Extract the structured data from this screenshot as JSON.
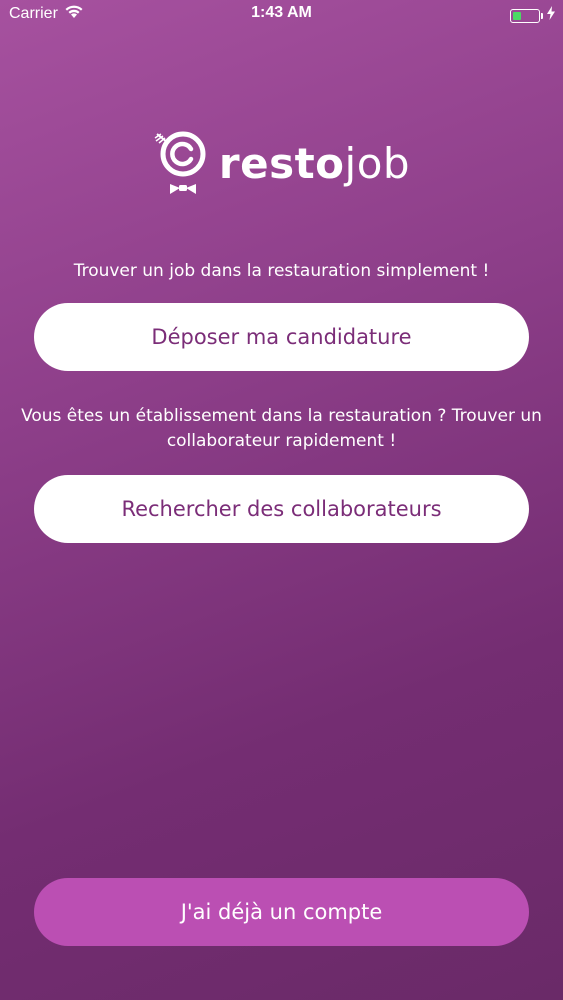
{
  "status_bar": {
    "carrier": "Carrier",
    "time": "1:43 AM",
    "icons": [
      "wifi-icon",
      "battery-icon",
      "charging-icon"
    ]
  },
  "logo": {
    "text_bold": "resto",
    "text_light": "job",
    "icon": "chef-logo-icon"
  },
  "tagline": "Trouver un job dans la restauration simplement !",
  "apply_button": "Déposer ma candidature",
  "establishment_text": "Vous êtes un établissement dans la restauration ? Trouver un collaborateur rapidement !",
  "search_button": "Rechercher des collaborateurs",
  "account_button": "J'ai déjà un compte",
  "colors": {
    "background_top": "#a6519f",
    "background_bottom": "#6a2a68",
    "button_text": "#7b2d78",
    "account_button_bg": "#bb4fb3",
    "battery_fill": "#4cd964"
  }
}
